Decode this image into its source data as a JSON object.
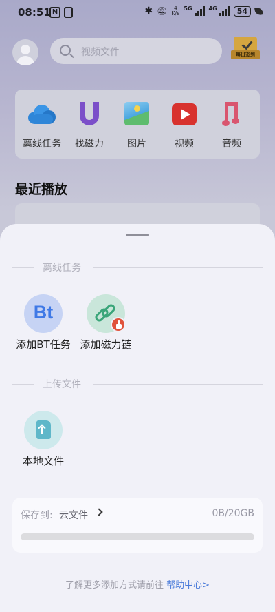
{
  "status_bar": {
    "time": "08:51",
    "network_speed_value": "4",
    "network_speed_unit": "K/s",
    "signal_1_label": "5G",
    "signal_2_label": "4G",
    "battery": "54"
  },
  "header": {
    "search_placeholder": "视频文件",
    "checkin_label": "每日签到"
  },
  "categories": [
    {
      "label": "离线任务",
      "icon": "cloud-icon"
    },
    {
      "label": "找磁力",
      "icon": "magnet-icon"
    },
    {
      "label": "图片",
      "icon": "photo-icon"
    },
    {
      "label": "视频",
      "icon": "video-play-icon"
    },
    {
      "label": "音频",
      "icon": "music-note-icon"
    }
  ],
  "recent": {
    "title": "最近播放"
  },
  "sheet": {
    "offline_section_title": "离线任务",
    "offline_actions": [
      {
        "label": "添加BT任务",
        "icon_text": "Bt",
        "icon": "bt-icon"
      },
      {
        "label": "添加磁力链",
        "icon": "link-icon"
      }
    ],
    "upload_section_title": "上传文件",
    "upload_actions": [
      {
        "label": "本地文件",
        "icon": "file-upload-icon"
      }
    ],
    "save_to": {
      "label": "保存到:",
      "folder": "云文件",
      "quota": "0B/20GB",
      "usage_fraction": 0
    },
    "footer_text": "了解更多添加方式请前往",
    "footer_link": "帮助中心>"
  },
  "colors": {
    "accent_blue": "#4a7bd9",
    "sheet_bg": "#f1f1f8"
  }
}
